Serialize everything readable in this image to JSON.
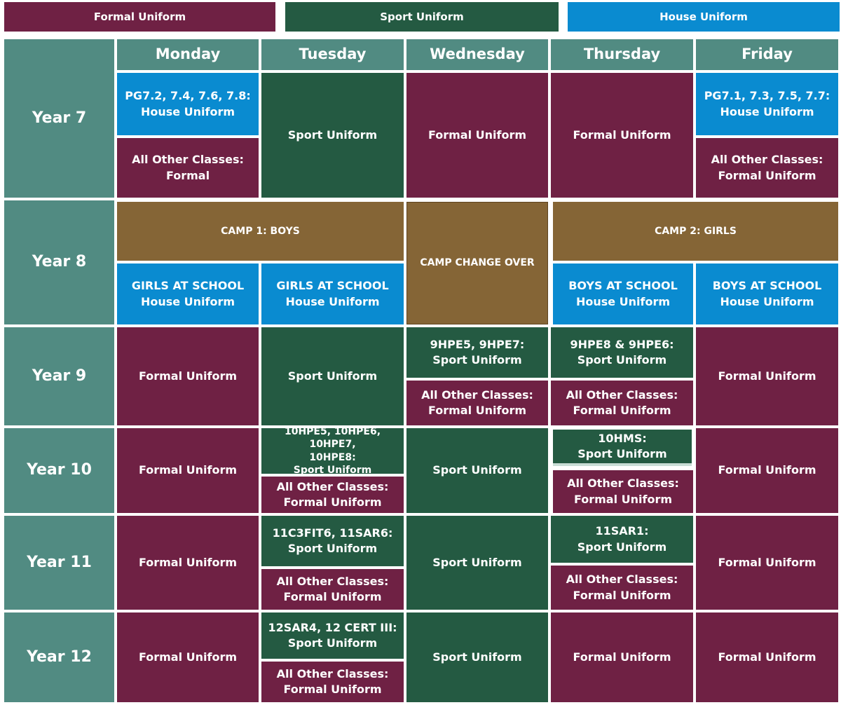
{
  "colors": {
    "formal": "#6f2144",
    "sport": "#245a42",
    "house": "#0a8bd0",
    "camp": "#856536",
    "header": "#518b82"
  },
  "legend": {
    "formal": "Formal Uniform",
    "sport": "Sport Uniform",
    "house": "House Uniform"
  },
  "days": [
    "Monday",
    "Tuesday",
    "Wednesday",
    "Thursday",
    "Friday"
  ],
  "years": [
    "Year 7",
    "Year 8",
    "Year 9",
    "Year 10",
    "Year 11",
    "Year 12"
  ],
  "cells": {
    "y7_mon_a": "PG7.2, 7.4, 7.6, 7.8:\nHouse  Uniform",
    "y7_mon_b": "All Other Classes:\nFormal",
    "y7_tue": "Sport Uniform",
    "y7_wed": "Formal Uniform",
    "y7_thu": "Formal Uniform",
    "y7_fri_a": "PG7.1, 7.3, 7.5, 7.7:\nHouse  Uniform",
    "y7_fri_b": "All Other Classes:\nFormal  Uniform",
    "y8_camp1": "CAMP 1: BOYS",
    "y8_change": "CAMP CHANGE OVER",
    "y8_camp2": "CAMP 2: GIRLS",
    "y8_mon": "GIRLS AT SCHOOL\nHouse Uniform",
    "y8_tue": "GIRLS AT SCHOOL\nHouse Uniform",
    "y8_thu": "BOYS AT SCHOOL\nHouse Uniform",
    "y8_fri": "BOYS AT SCHOOL\nHouse Uniform",
    "y9_mon": "Formal Uniform",
    "y9_tue": "Sport Uniform",
    "y9_wed_a": "9HPE5, 9HPE7:\nSport Uniform",
    "y9_wed_b": "All Other Classes:\nFormal Uniform",
    "y9_thu_a": "9HPE8 & 9HPE6:\nSport Uniform",
    "y9_thu_b": "All Other Classes:\nFormal  Uniform",
    "y9_fri": "Formal Uniform",
    "y10_mon": "Formal Uniform",
    "y10_tue_a": "10HPE5, 10HPE6, 10HPE7,\n10HPE8:\nSport Uniform",
    "y10_tue_b": "All Other Classes:\nFormal Uniform",
    "y10_wed": "Sport Uniform",
    "y10_thu_a": "10HMS:\nSport Uniform",
    "y10_thu_b": "All Other Classes:\nFormal Uniform",
    "y10_fri": "Formal Uniform",
    "y11_mon": "Formal Uniform",
    "y11_tue_a": "11C3FIT6, 11SAR6:\nSport Uniform",
    "y11_tue_b": "All Other Classes:\nFormal Uniform",
    "y11_wed": "Sport Uniform",
    "y11_thu_a": "11SAR1:\nSport Uniform",
    "y11_thu_b": "All Other Classes:\nFormal Uniform",
    "y11_fri": "Formal Uniform",
    "y12_mon": "Formal Uniform",
    "y12_tue_a": "12SAR4, 12 CERT III:\nSport Uniform",
    "y12_tue_b": "All Other Classes:\nFormal Uniform",
    "y12_wed": "Sport Uniform",
    "y12_thu": "Formal Uniform",
    "y12_fri": "Formal Uniform"
  }
}
